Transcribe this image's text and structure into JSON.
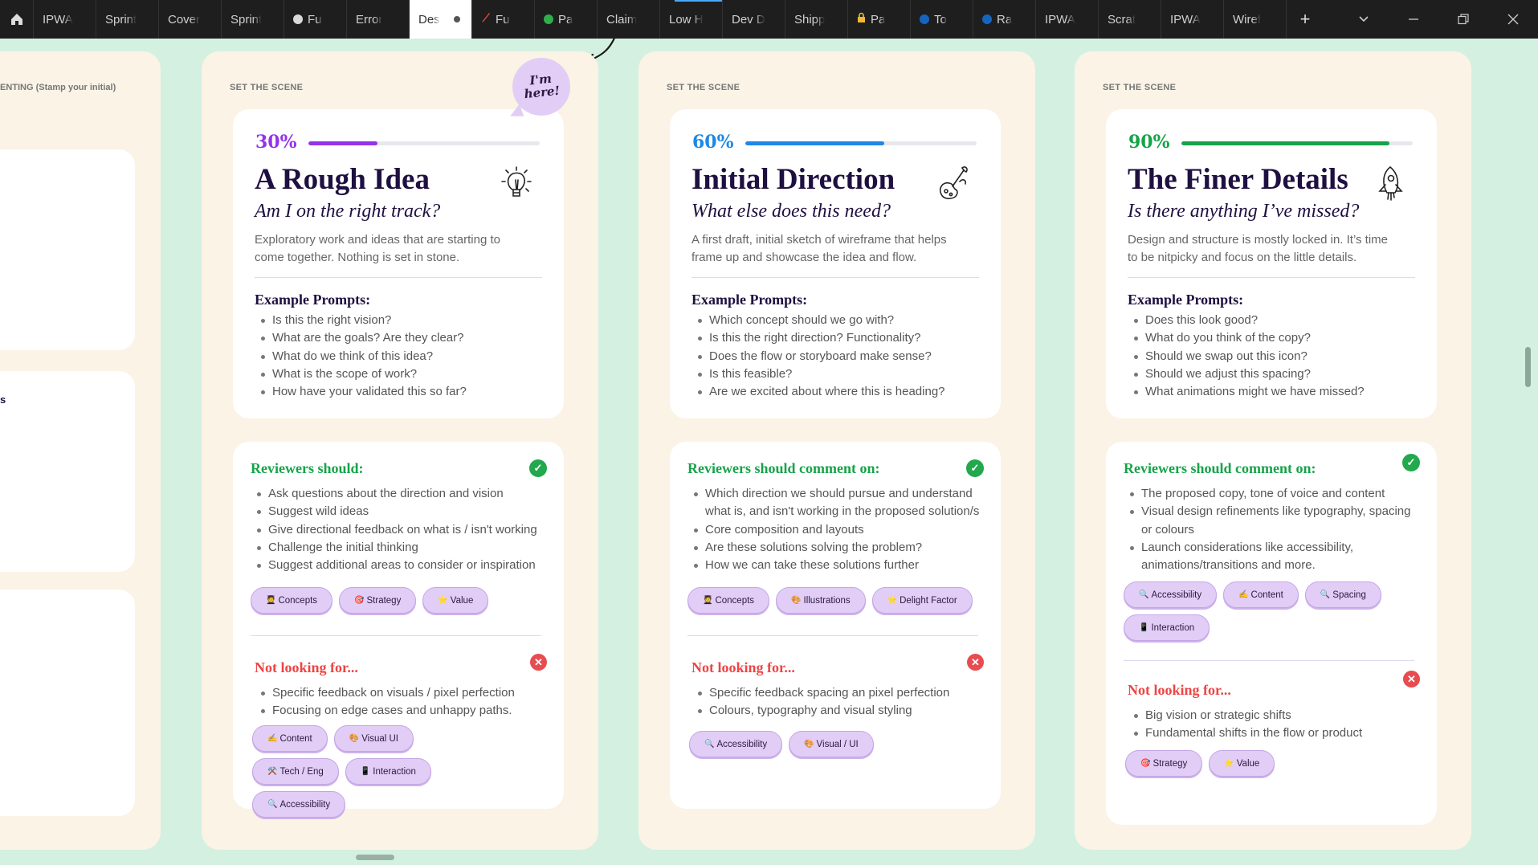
{
  "tabs": [
    {
      "label": "IPWA"
    },
    {
      "label": "Sprint"
    },
    {
      "label": "Cover"
    },
    {
      "label": "Sprint"
    },
    {
      "label": "Fu",
      "dot": "#d9d9d9"
    },
    {
      "label": "Error"
    },
    {
      "label": "Des",
      "active": true
    },
    {
      "label": "Fu",
      "icon": "pencil-icon"
    },
    {
      "label": "Pa",
      "dot": "#2fae4a"
    },
    {
      "label": "Claim"
    },
    {
      "label": "Low H"
    },
    {
      "label": "Dev D"
    },
    {
      "label": "Shipp"
    },
    {
      "label": "Pa",
      "icon": "lock-icon"
    },
    {
      "label": "To",
      "dot": "#1565c0"
    },
    {
      "label": "Ra",
      "dot": "#1565c0"
    },
    {
      "label": "IPWA"
    },
    {
      "label": "Scrat"
    },
    {
      "label": "IPWA"
    },
    {
      "label": "Wiref"
    }
  ],
  "partial_column": {
    "label": "ENTING (Stamp your initial)",
    "fragment": "s"
  },
  "bubble": {
    "line1": "I'm",
    "line2": "here!"
  },
  "columns": [
    {
      "scene": "SET THE SCENE",
      "pct": "30%",
      "progress": 0.3,
      "color": "#9333ea",
      "title": "A Rough Idea",
      "subtitle": "Am I on the right track?",
      "icon": "lightbulb-icon",
      "description": "Exploratory work and ideas that are starting to come together. Nothing is set in stone.",
      "prompts_heading": "Example Prompts:",
      "prompts": [
        "Is this the right vision?",
        "What are the goals? Are they clear?",
        "What do we think of this idea?",
        "What is the scope of work?",
        "How have your validated this so far?"
      ],
      "reviewers_heading": "Reviewers should:",
      "reviewers": [
        "Ask questions about the direction and vision",
        "Suggest wild ideas",
        "Give directional feedback on what is / isn't working",
        "Challenge the initial thinking",
        "Suggest additional areas to consider or inspiration"
      ],
      "reviewer_tags": [
        {
          "emoji": "🧑‍🎓",
          "label": "Concepts"
        },
        {
          "emoji": "🎯",
          "label": "Strategy"
        },
        {
          "emoji": "⭐",
          "label": "Value"
        }
      ],
      "not_heading": "Not looking for...",
      "not_items": [
        "Specific feedback on visuals / pixel perfection",
        "Focusing on edge cases and unhappy paths."
      ],
      "not_tags": [
        {
          "emoji": "✍️",
          "label": "Content"
        },
        {
          "emoji": "🎨",
          "label": "Visual UI"
        },
        {
          "emoji": "⚒️",
          "label": "Tech / Eng"
        },
        {
          "emoji": "📱",
          "label": "Interaction"
        },
        {
          "emoji": "🔍",
          "label": "Accessibility"
        }
      ]
    },
    {
      "scene": "SET THE SCENE",
      "pct": "60%",
      "progress": 0.6,
      "color": "#1e88e5",
      "title": "Initial Direction",
      "subtitle": "What else does this need?",
      "icon": "paint-palette-icon",
      "description": "A first draft, initial sketch of wireframe that helps frame up and showcase the idea and flow.",
      "prompts_heading": "Example Prompts:",
      "prompts": [
        "Which concept should we go with?",
        "Is this the right direction? Functionality?",
        "Does the flow or storyboard make sense?",
        "Is this feasible?",
        "Are we excited about where this is heading?"
      ],
      "reviewers_heading": "Reviewers should comment on:",
      "reviewers": [
        "Which direction we should pursue and understand what is, and isn't working in the proposed solution/s",
        "Core composition and layouts",
        "Are these solutions solving the problem?",
        "How we can take these solutions further"
      ],
      "reviewer_tags": [
        {
          "emoji": "🧑‍🎓",
          "label": "Concepts"
        },
        {
          "emoji": "🎨",
          "label": "Illustrations"
        },
        {
          "emoji": "⭐",
          "label": "Delight Factor"
        }
      ],
      "not_heading": "Not looking for...",
      "not_items": [
        "Specific feedback spacing an pixel perfection",
        "Colours, typography and visual styling"
      ],
      "not_tags": [
        {
          "emoji": "🔍",
          "label": "Accessibility"
        },
        {
          "emoji": "🎨",
          "label": "Visual / UI"
        }
      ]
    },
    {
      "scene": "SET THE SCENE",
      "pct": "90%",
      "progress": 0.9,
      "color": "#16a34a",
      "title": "The Finer Details",
      "subtitle": "Is there anything I’ve missed?",
      "icon": "rocket-icon",
      "description": "Design and structure is mostly locked in. It’s time to be nitpicky and focus on the little details.",
      "prompts_heading": "Example Prompts:",
      "prompts": [
        "Does this look good?",
        "What do you think of the copy?",
        "Should we swap out this icon?",
        "Should we adjust this spacing?",
        "What animations might we have missed?"
      ],
      "reviewers_heading": "Reviewers should comment on:",
      "reviewers": [
        "The proposed copy, tone of voice and content",
        "Visual design refinements like typography, spacing or colours",
        "Launch considerations like accessibility, animations/transitions and more."
      ],
      "reviewer_tags": [
        {
          "emoji": "🔍",
          "label": "Accessibility"
        },
        {
          "emoji": "✍️",
          "label": "Content"
        },
        {
          "emoji": "🔍",
          "label": "Spacing"
        },
        {
          "emoji": "📱",
          "label": "Interaction"
        }
      ],
      "not_heading": "Not looking for...",
      "not_items": [
        "Big vision or strategic shifts",
        "Fundamental shifts in the flow or product"
      ],
      "not_tags": [
        {
          "emoji": "🎯",
          "label": "Strategy"
        },
        {
          "emoji": "⭐",
          "label": "Value"
        }
      ]
    }
  ]
}
